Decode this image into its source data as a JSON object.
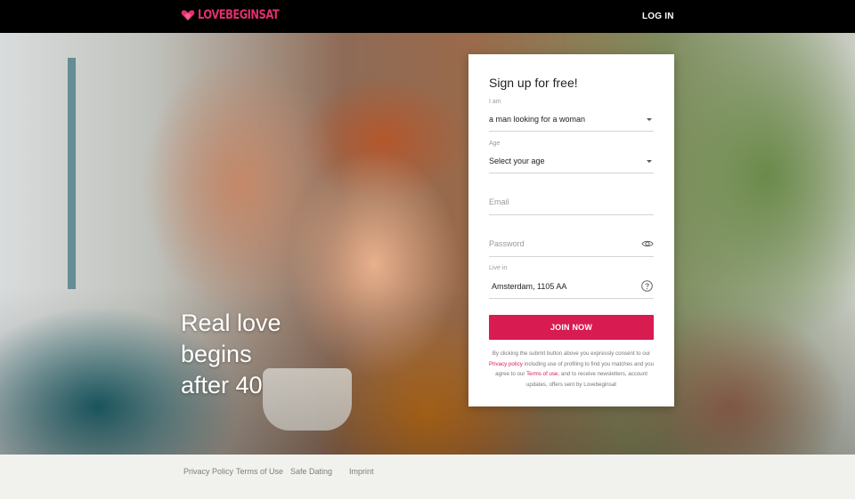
{
  "header": {
    "logo_text": "LOVEBEGINSAT",
    "login_label": "LOG IN"
  },
  "hero": {
    "tagline_lines": [
      "Real love",
      "begins",
      "after 40"
    ]
  },
  "signup": {
    "title": "Sign up for free!",
    "gender": {
      "label": "I am",
      "value": "a man looking for a woman"
    },
    "age": {
      "label": "Age",
      "value": "Select your age"
    },
    "email": {
      "placeholder": "Email"
    },
    "password": {
      "placeholder": "Password"
    },
    "location": {
      "label": "Live in",
      "value": "Amsterdam, 1105 AA"
    },
    "join_label": "JOIN NOW",
    "legal": {
      "part1": "By clicking the submit button above you expressly consent to our ",
      "privacy_link": "Privacy policy",
      "part2": " including use of profiling to find you matches and you agree to our ",
      "terms_link": "Terms of use",
      "part3": ", and to receive newsletters, account updates, offers sent by Lovebeginsat"
    }
  },
  "footer": {
    "links": [
      "Privacy Policy",
      "Terms of Use",
      "Safe Dating",
      "Imprint"
    ]
  },
  "colors": {
    "accent": "#d81b50",
    "logo": "#e0306c",
    "header_bg": "#000000",
    "footer_bg": "#f1f2ee"
  },
  "icons": {
    "logo": "heart-icon",
    "password_toggle": "eye-icon",
    "location_help": "help-icon",
    "select_arrow": "caret-down-icon"
  }
}
